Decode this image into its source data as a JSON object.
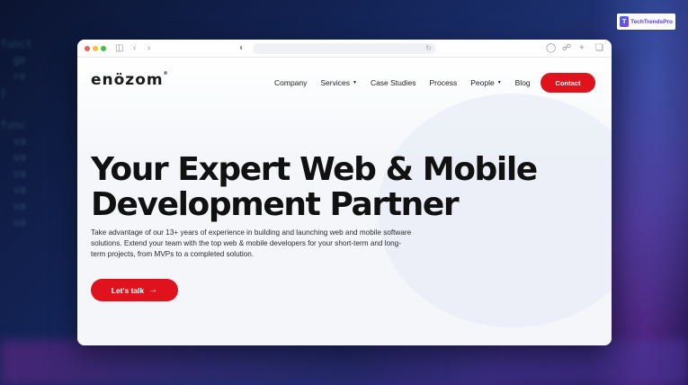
{
  "watermark": {
    "text": "TechTrendsPro",
    "icon": "tt-logo-icon"
  },
  "background_code": [
    "funct",
    "  ge",
    "  re",
    "}",
    "",
    "func",
    "  va",
    "  va",
    "  va",
    "  va",
    "  va",
    "  va",
    "",
    "",
    "",
    ""
  ],
  "browser": {
    "window_controls": [
      "close",
      "minimize",
      "maximize"
    ],
    "icons": [
      "sidebar-icon",
      "back-icon",
      "forward-icon",
      "shield-icon",
      "reload-icon",
      "download-icon",
      "share-icon",
      "new-tab-icon",
      "tabs-icon"
    ]
  },
  "site": {
    "brand": "enözom",
    "brand_mark": "®",
    "nav": [
      {
        "label": "Company",
        "has_caret": false
      },
      {
        "label": "Services",
        "has_caret": true
      },
      {
        "label": "Case Studies",
        "has_caret": false
      },
      {
        "label": "Process",
        "has_caret": false
      },
      {
        "label": "People",
        "has_caret": true
      },
      {
        "label": "Blog",
        "has_caret": false
      }
    ],
    "contact_label": "Contact",
    "hero": {
      "title_line1": "Your Expert Web & Mobile",
      "title_line2": "Development Partner",
      "description": "Take advantage of our 13+ years of experience in building and launching web and mobile software solutions. Extend your team with the top web & mobile developers for your short-term and long-term projects, from MVPs to a completed solution.",
      "cta_label": "Let's talk"
    }
  },
  "colors": {
    "accent": "#e0121d",
    "text": "#111111"
  }
}
